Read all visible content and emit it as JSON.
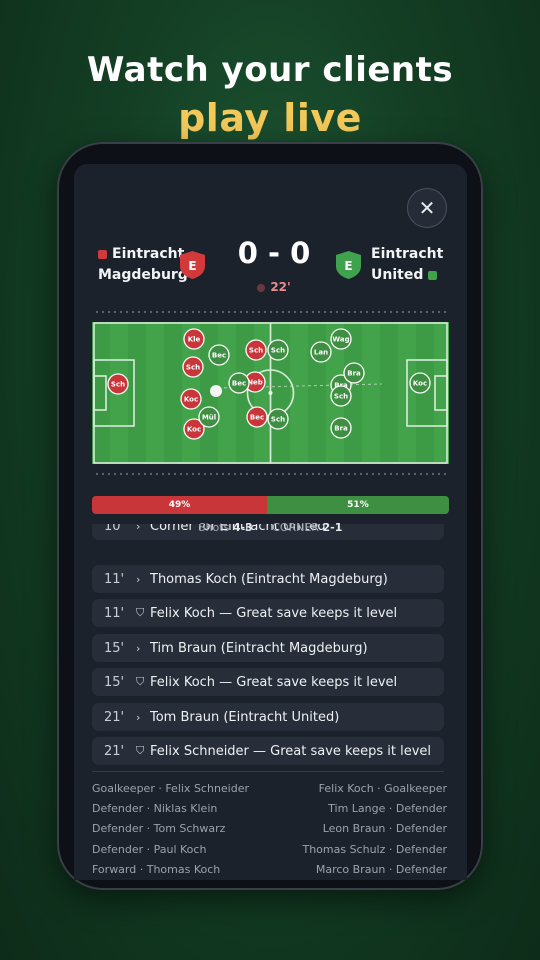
{
  "promo": {
    "line1": "Watch your clients",
    "line2": "play live"
  },
  "close_icon": "close-icon",
  "match": {
    "home": {
      "line1": "Eintracht",
      "line2": "Magdeburg",
      "badge_letter": "E",
      "color": "#d2393a"
    },
    "away": {
      "line1": "Eintracht",
      "line2": "United",
      "badge_letter": "E",
      "color": "#3fa34d"
    },
    "score": "0 - 0",
    "minute": "22'"
  },
  "pitch": {
    "home_players": [
      "Sch",
      "Kle",
      "Sch",
      "Koc",
      "Koc",
      "Sch",
      "Neb",
      "Bec"
    ],
    "away_players": [
      "Bec",
      "Bec",
      "Mül",
      "Sch",
      "Sch",
      "Bra",
      "Wag",
      "Lan",
      "Bra",
      "Sch",
      "Bra",
      "Koc"
    ],
    "away_players_extra": [
      "Bra"
    ],
    "home_players_extra": [
      "Sch",
      "Bra"
    ]
  },
  "possession": {
    "home": "49%",
    "away": "51%",
    "home_value": 49,
    "away_value": 51
  },
  "stats": {
    "shots_label": "Shots",
    "shots_value": "4-3",
    "corner_label": "CORNER",
    "corner_value": "2-1"
  },
  "events": [
    {
      "min": "10'",
      "icon": "chevron-right-icon",
      "text": "Corner for Eintracht United"
    },
    {
      "min": "11'",
      "icon": "chevron-right-icon",
      "text": "Thomas Koch (Eintracht Magdeburg)"
    },
    {
      "min": "11'",
      "icon": "shield-icon",
      "text": "Felix Koch — Great save keeps it level"
    },
    {
      "min": "15'",
      "icon": "chevron-right-icon",
      "text": "Tim Braun (Eintracht Magdeburg)"
    },
    {
      "min": "15'",
      "icon": "shield-icon",
      "text": "Felix Koch — Great save keeps it level"
    },
    {
      "min": "21'",
      "icon": "chevron-right-icon",
      "text": "Tom Braun (Eintracht United)"
    },
    {
      "min": "21'",
      "icon": "shield-icon",
      "text": "Felix Schneider — Great save keeps it level"
    }
  ],
  "lineup_home": [
    "Goalkeeper · Felix Schneider",
    "Defender · Niklas Klein",
    "Defender · Tom Schwarz",
    "Defender · Paul Koch",
    "Forward · Thomas Koch"
  ],
  "lineup_away": [
    "Felix Koch · Goalkeeper",
    "Tim Lange · Defender",
    "Leon Braun · Defender",
    "Thomas Schulz · Defender",
    "Marco Braun · Defender"
  ]
}
